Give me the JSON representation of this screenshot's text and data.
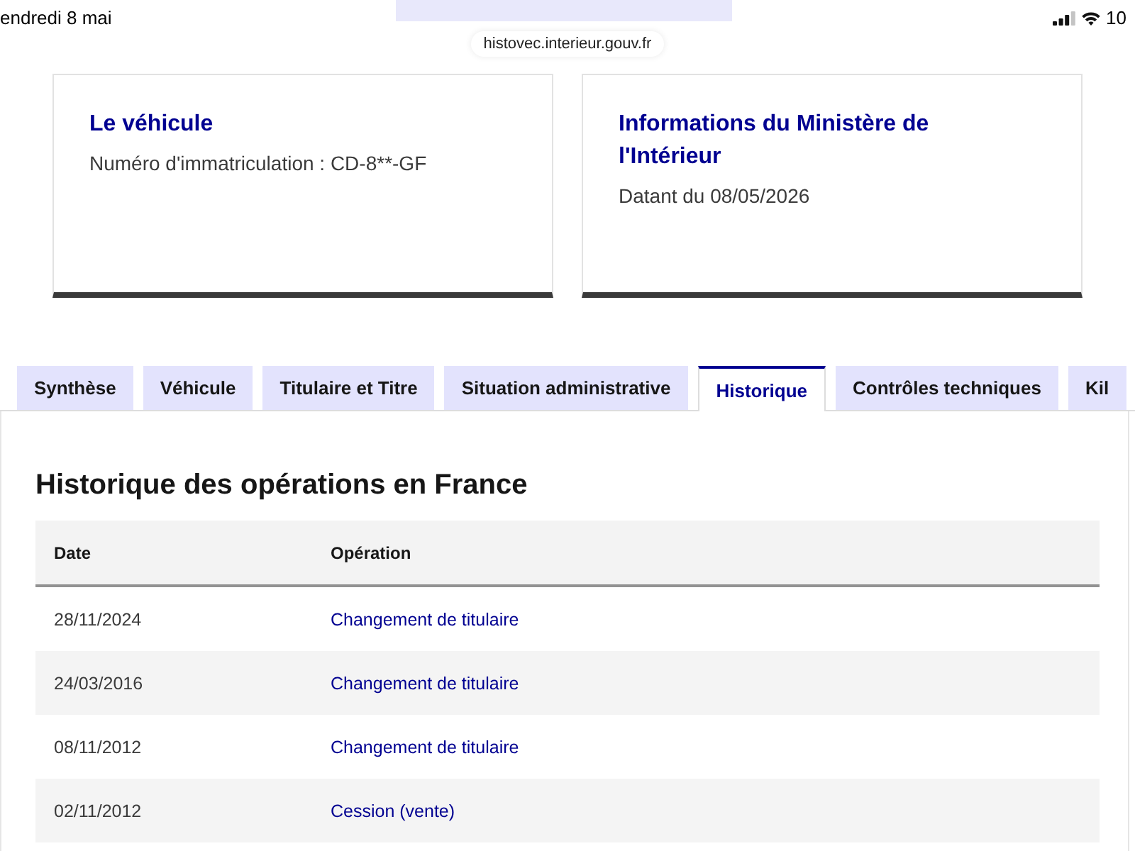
{
  "status_bar": {
    "time": "endredi 8 mai",
    "battery": "10"
  },
  "address_bar": {
    "url": "histovec.interieur.gouv.fr"
  },
  "cards": [
    {
      "title": "Le véhicule",
      "text": "Numéro d'immatriculation : CD-8**-GF"
    },
    {
      "title": "Informations du Ministère de l'Intérieur",
      "text": "Datant du 08/05/2026"
    }
  ],
  "tabs": [
    {
      "label": "Synthèse",
      "selected": false
    },
    {
      "label": "Véhicule",
      "selected": false
    },
    {
      "label": "Titulaire et Titre",
      "selected": false
    },
    {
      "label": "Situation administrative",
      "selected": false
    },
    {
      "label": "Historique",
      "selected": true
    },
    {
      "label": "Contrôles techniques",
      "selected": false
    },
    {
      "label": "Kil",
      "selected": false
    }
  ],
  "history": {
    "title": "Historique des opérations en France",
    "table": {
      "columns": [
        "Date",
        "Opération"
      ],
      "rows": [
        [
          "28/11/2024",
          "Changement de titulaire"
        ],
        [
          "24/03/2016",
          "Changement de titulaire"
        ],
        [
          "08/11/2012",
          "Changement de titulaire"
        ],
        [
          "02/11/2012",
          "Cession (vente)"
        ]
      ]
    }
  }
}
